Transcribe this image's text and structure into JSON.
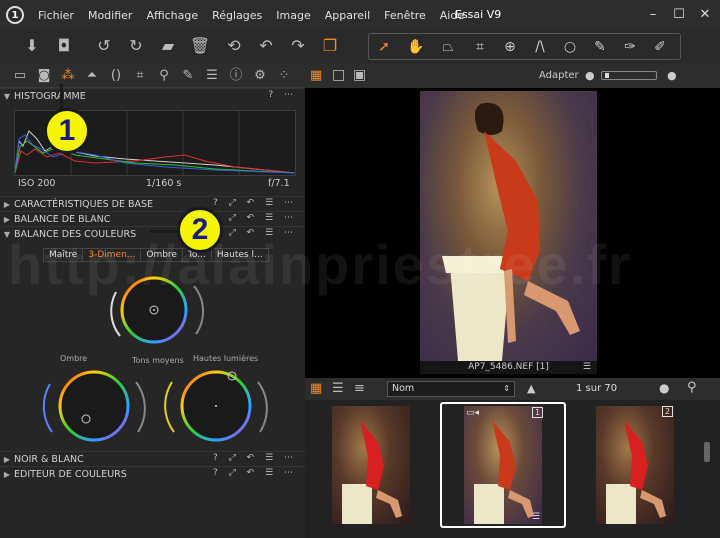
{
  "menu": {
    "logo": "1",
    "items": [
      "Fichier",
      "Modifier",
      "Affichage",
      "Réglages",
      "Image",
      "Appareil",
      "Fenêtre",
      "Aide"
    ],
    "window_title": "Essai V9"
  },
  "viewer": {
    "adapter_label": "Adapter",
    "caption": "AP7_5486.NEF [1]"
  },
  "histogram": {
    "title": "HISTOGRAMME",
    "iso": "ISO 200",
    "shutter": "1/160 s",
    "aperture": "f/7.1"
  },
  "sections": {
    "base": "CARACTÉRISTIQUES DE BASE",
    "white_balance": "BALANCE DE BLANC",
    "color_balance": "BALANCE DES COULEURS",
    "bw": "NOIR & BLANC",
    "color_editor": "EDITEUR DE COULEURS"
  },
  "color_balance": {
    "tabs": [
      "Maître",
      "3-Dimen...",
      "Ombre",
      "To...",
      "Hautes l..."
    ],
    "active_tab": 1,
    "labels": {
      "shadow": "Ombre",
      "midtones": "Tons moyens",
      "highlights": "Hautes lumières"
    }
  },
  "browser": {
    "sort_value": "Nom",
    "counter": "1 sur 70",
    "thumb_badges": [
      "1",
      "2"
    ]
  },
  "annotations": [
    "1",
    "2"
  ],
  "watermark": "http://alainpriestree.fr",
  "colors": {
    "accent": "#f08c28",
    "annotation": "#f5f500",
    "panel": "#262626",
    "viewer_bg": "#000000"
  }
}
